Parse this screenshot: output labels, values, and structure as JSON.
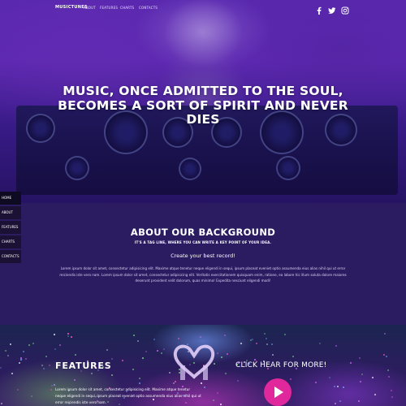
{
  "nav": {
    "brand": "MUSICTUNES",
    "links": [
      "ABOUT",
      "FEATURES",
      "CHARTS",
      "CONTACTS"
    ],
    "social_icons": [
      "facebook-icon",
      "twitter-icon",
      "instagram-icon"
    ]
  },
  "hero": {
    "title": "MUSIC, ONCE ADMITTED TO THE SOUL, BECOMES A SORT OF SPIRIT AND NEVER DIES"
  },
  "sidebar": {
    "items": [
      "HOME",
      "ABOUT",
      "FEATURES",
      "CHARTS",
      "CONTACTS"
    ],
    "active": "HOME"
  },
  "about": {
    "title": "ABOUT OUR BACKGROUND",
    "tagline": "IT'S A TAG LINE, WHERE YOU CAN WRITE A KEY POINT OF YOUR IDEA.",
    "subtitle": "Create your best record!",
    "body": "Lorem ipsum dolor sit amet, consectetur adipisicing elit. Maxime atque tenetur neque eligendi in sequi, ipsum placeat eveniet optio assumenda eius alias nihil qui ut error reiciendis iste vero nam. Lorem ipsum dolor sit amet, consectetur adipisicing elit. Veritatis exercitationem quisquam enim, ratione, ea labore hic illum soluta dolore maiores deserunt provident velit dolorum, quas minima! Expedita nesciunt eligendi modi!"
  },
  "features": {
    "title": "FEATURES",
    "cta": "CLICK HEAR FOR MORE!",
    "body": "Lorem ipsum dolor sit amet, consectetur adipisicing elit. Maxime atque tenetur neque eligendi in sequi, ipsum placeat eveniet optio assumenda eius alias nihil qui ut error reiciendis iste vero nam."
  },
  "colors": {
    "accent": "#e0279b",
    "about_bg": "#2b1c61",
    "sidebar_bg": "#1a1134"
  }
}
